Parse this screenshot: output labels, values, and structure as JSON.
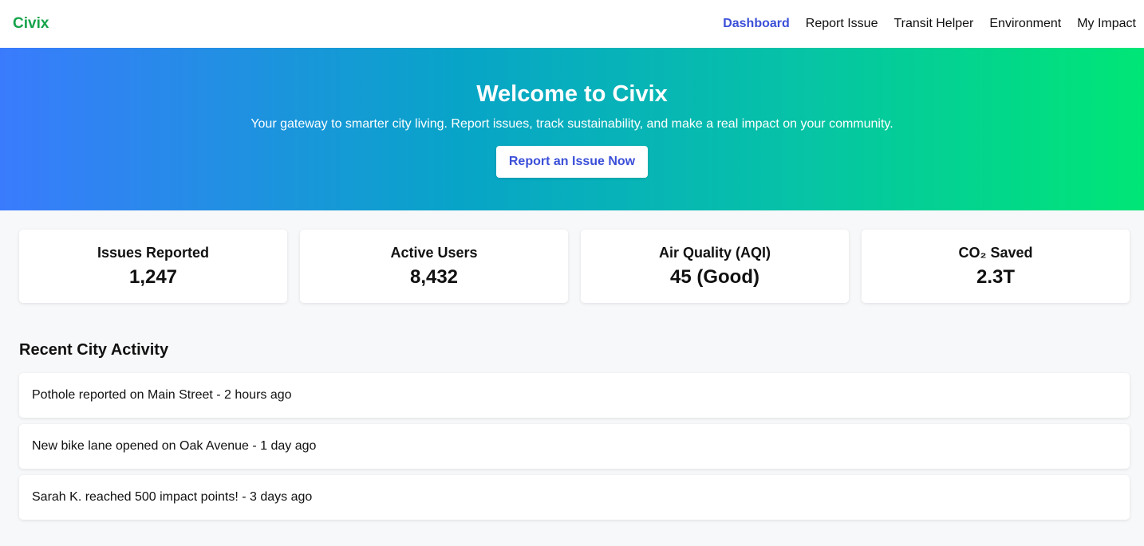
{
  "brand": "Civix",
  "nav": {
    "items": [
      {
        "label": "Dashboard",
        "active": true
      },
      {
        "label": "Report Issue"
      },
      {
        "label": "Transit Helper"
      },
      {
        "label": "Environment"
      },
      {
        "label": "My Impact"
      }
    ]
  },
  "hero": {
    "title": "Welcome to Civix",
    "subtitle": "Your gateway to smarter city living. Report issues, track sustainability, and make a real impact on your community.",
    "button_label": "Report an Issue Now"
  },
  "stats": [
    {
      "label": "Issues Reported",
      "value": "1,247"
    },
    {
      "label": "Active Users",
      "value": "8,432"
    },
    {
      "label": "Air Quality (AQI)",
      "value": "45 (Good)"
    },
    {
      "label": "CO₂ Saved",
      "value": "2.3T"
    }
  ],
  "activity": {
    "title": "Recent City Activity",
    "items": [
      "Pothole reported on Main Street - 2 hours ago",
      "New bike lane opened on Oak Avenue - 1 day ago",
      "Sarah K. reached 500 impact points! - 3 days ago"
    ]
  },
  "colors": {
    "brand": "#16a34a",
    "accent": "#3b4fd8",
    "hero_gradient": [
      "#3a7bfd",
      "#00e676"
    ]
  }
}
